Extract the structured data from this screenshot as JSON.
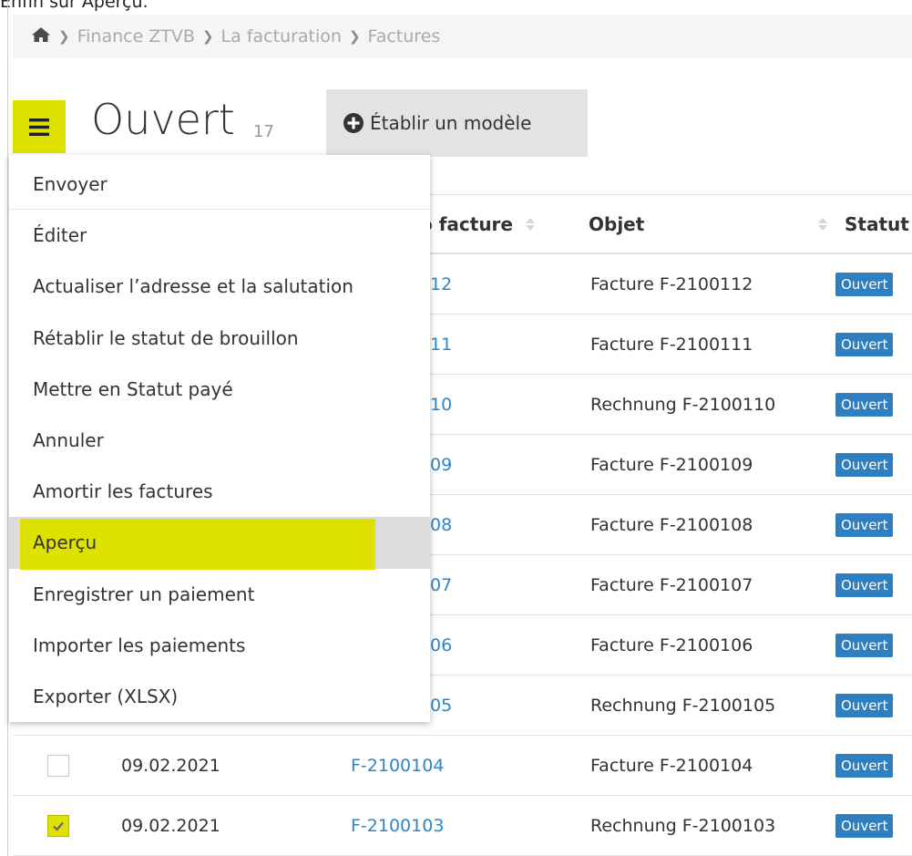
{
  "caption": "Enfin sur Aperçu.",
  "breadcrumb": [
    "Finance ZTVB",
    "La facturation",
    "Factures"
  ],
  "page": {
    "title": "Ouvert",
    "count": "17",
    "template_button": "Établir un modèle"
  },
  "table": {
    "headers": {
      "number": "o facture",
      "object": "Objet",
      "status": "Statut"
    },
    "rows": [
      {
        "number": "12",
        "object": "Facture F-2100112",
        "status": "Ouvert"
      },
      {
        "number": "11",
        "object": "Facture F-2100111",
        "status": "Ouvert"
      },
      {
        "number": "10",
        "object": "Rechnung F-2100110",
        "status": "Ouvert"
      },
      {
        "number": "09",
        "object": "Facture F-2100109",
        "status": "Ouvert"
      },
      {
        "number": "08",
        "object": "Facture F-2100108",
        "status": "Ouvert"
      },
      {
        "number": "07",
        "object": "Facture F-2100107",
        "status": "Ouvert"
      },
      {
        "number": "06",
        "object": "Facture F-2100106",
        "status": "Ouvert"
      },
      {
        "number": "05",
        "object": "Rechnung F-2100105",
        "status": "Ouvert"
      },
      {
        "date": "09.02.2021",
        "number": "F-2100104",
        "object": "Facture F-2100104",
        "status": "Ouvert",
        "checked": false
      },
      {
        "date": "09.02.2021",
        "number": "F-2100103",
        "object": "Rechnung F-2100103",
        "status": "Ouvert",
        "checked": true
      }
    ]
  },
  "menu": {
    "items": [
      "Envoyer",
      "Éditer",
      "Actualiser l’adresse et la salutation",
      "Rétablir le statut de brouillon",
      "Mettre en Statut payé",
      "Annuler",
      "Amortir les factures",
      "Aperçu",
      "Enregistrer un paiement",
      "Importer les paiements",
      "Exporter (XLSX)"
    ],
    "highlighted_index": 7
  },
  "colors": {
    "highlight": "#dfe100",
    "badge": "#2d7fc2",
    "link": "#2e86c8"
  }
}
